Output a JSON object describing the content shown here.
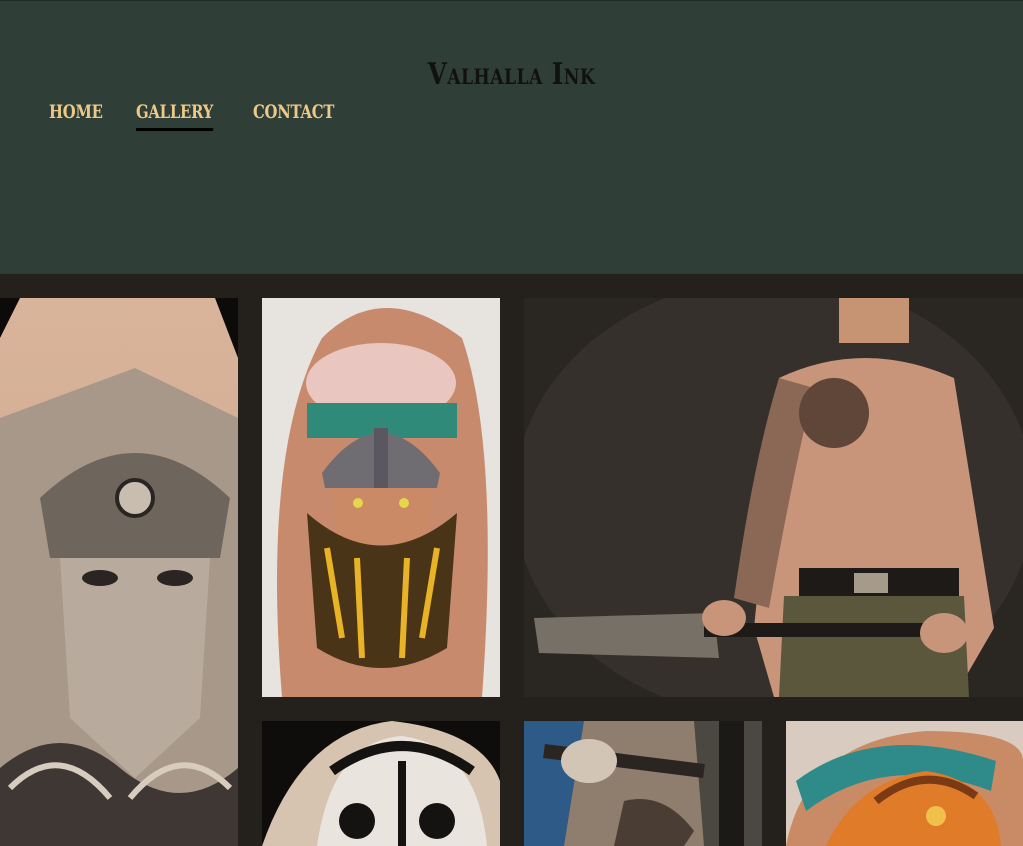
{
  "site": {
    "title": "Valhalla Ink"
  },
  "nav": {
    "items": [
      {
        "label": "HOME",
        "active": false
      },
      {
        "label": "GALLERY",
        "active": true
      },
      {
        "label": "CONTACT",
        "active": false
      }
    ]
  },
  "colors": {
    "header_bg": "#2f3f37",
    "page_bg": "#24211d",
    "nav_text": "#ecc98a",
    "title_text": "#111111"
  },
  "gallery": {
    "images": [
      {
        "subject": "odin-back-tattoo"
      },
      {
        "subject": "viking-head-arm-tattoo"
      },
      {
        "subject": "tattooed-man-with-cleaver"
      },
      {
        "subject": "viking-helmet-tattoo"
      },
      {
        "subject": "warrior-sleeve-tattoo"
      },
      {
        "subject": "color-dragon-tattoo"
      }
    ]
  }
}
